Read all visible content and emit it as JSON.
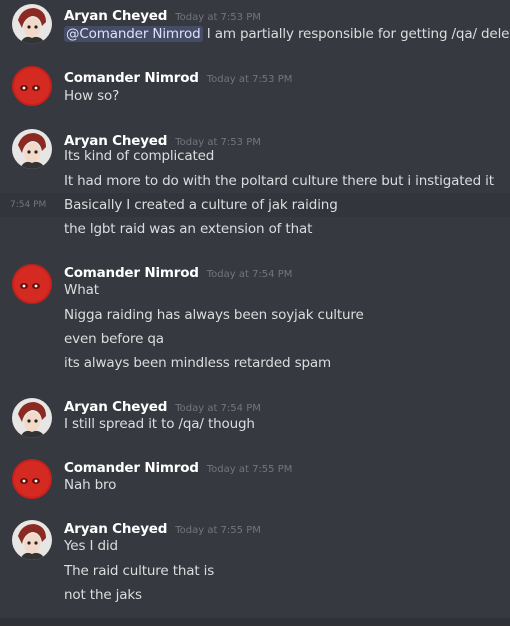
{
  "users": {
    "aryan": "Aryan Cheyed",
    "nimrod": "Comander Nimrod"
  },
  "groups": [
    {
      "author": "Aryan Cheyed",
      "timestamp": "Today at 7:53 PM",
      "lines": [
        {
          "mention": "@Comander Nimrod",
          "text": " I am partially responsible for getting /qa/ deleted"
        }
      ]
    },
    {
      "author": "Comander Nimrod",
      "timestamp": "Today at 7:53 PM",
      "lines": [
        {
          "text": "How so?"
        }
      ]
    },
    {
      "author": "Aryan Cheyed",
      "timestamp": "Today at 7:53 PM",
      "lines": [
        {
          "text": "Its kind of complicated"
        },
        {
          "text": "It had more to do with the poltard culture there but i instigated it"
        },
        {
          "text": "Basically I created a culture of jak raiding",
          "side_time": "7:54 PM"
        },
        {
          "text": "the lgbt raid was an extension of that"
        }
      ]
    },
    {
      "author": "Comander Nimrod",
      "timestamp": "Today at 7:54 PM",
      "lines": [
        {
          "text": "What"
        },
        {
          "text": "Nigga raiding has always been soyjak culture"
        },
        {
          "text": "even before qa"
        },
        {
          "text": "its always been mindless retarded spam"
        }
      ]
    },
    {
      "author": "Aryan Cheyed",
      "timestamp": "Today at 7:54 PM",
      "lines": [
        {
          "text": "I still spread it to /qa/ though"
        }
      ]
    },
    {
      "author": "Comander Nimrod",
      "timestamp": "Today at 7:55 PM",
      "lines": [
        {
          "text": "Nah bro"
        }
      ]
    },
    {
      "author": "Aryan Cheyed",
      "timestamp": "Today at 7:55 PM",
      "lines": [
        {
          "text": "Yes I did"
        },
        {
          "text": "The raid culture that is"
        },
        {
          "text": "not the jaks"
        }
      ]
    }
  ],
  "colors": {
    "background": "#36393f",
    "text": "#dcddde",
    "author": "#ffffff",
    "timestamp": "#72767d",
    "mention_bg": "#414675",
    "nimrod_avatar": "#c8201c"
  }
}
